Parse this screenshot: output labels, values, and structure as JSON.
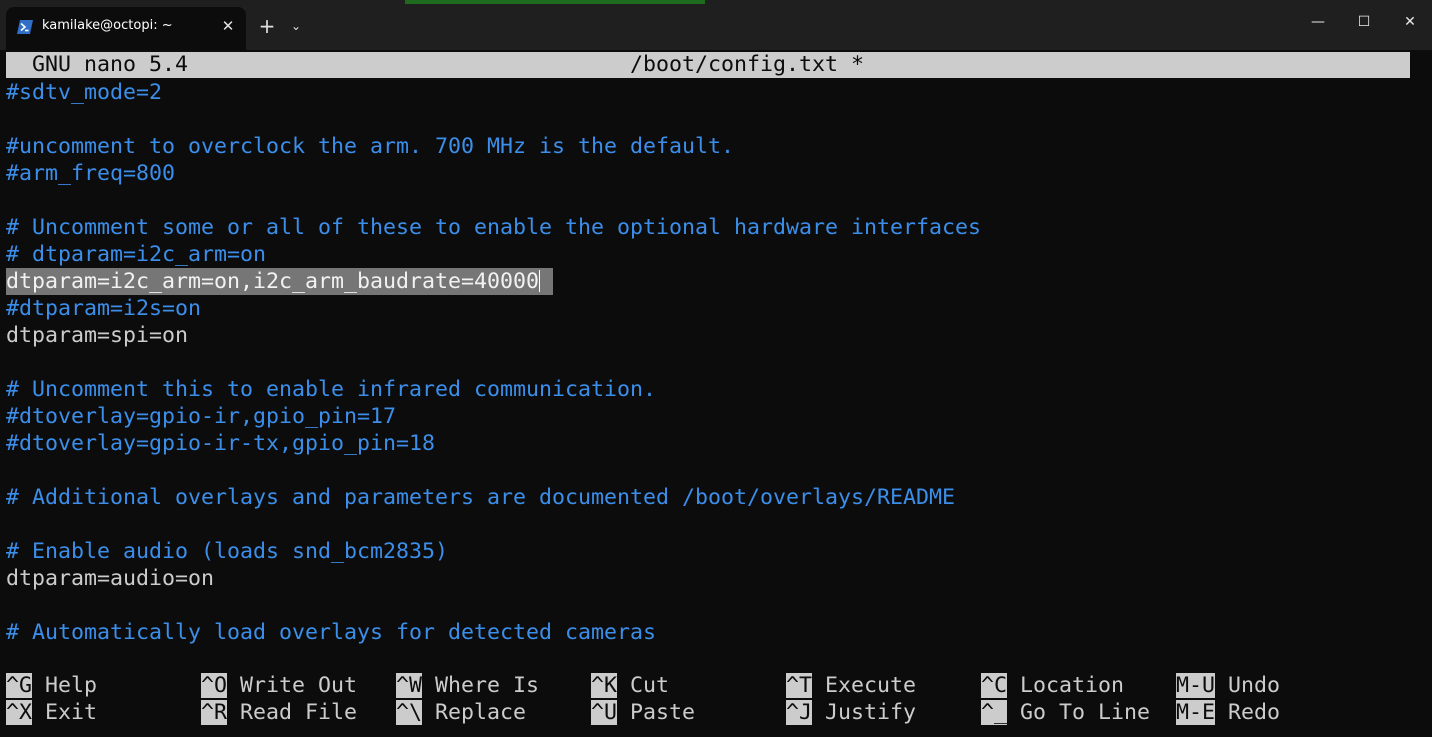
{
  "window": {
    "tab_title": "kamilake@octopi: ~",
    "tab_close_symbol": "✕",
    "new_tab_symbol": "+",
    "dropdown_symbol": "⌄",
    "minimize_symbol": "—",
    "maximize_symbol": "☐",
    "close_symbol": "✕"
  },
  "nano": {
    "version": "GNU nano 5.4",
    "filename": "/boot/config.txt *",
    "lines": [
      {
        "text": "#sdtv_mode=2",
        "kind": "comment"
      },
      {
        "text": "",
        "kind": "normal"
      },
      {
        "text": "#uncomment to overclock the arm. 700 MHz is the default.",
        "kind": "comment"
      },
      {
        "text": "#arm_freq=800",
        "kind": "comment"
      },
      {
        "text": "",
        "kind": "normal"
      },
      {
        "text": "# Uncomment some or all of these to enable the optional hardware interfaces",
        "kind": "comment"
      },
      {
        "text": "# dtparam=i2c_arm=on",
        "kind": "comment"
      },
      {
        "text": "dtparam=i2c_arm=on,i2c_arm_baudrate=40000",
        "kind": "selected"
      },
      {
        "text": "#dtparam=i2s=on",
        "kind": "comment"
      },
      {
        "text": "dtparam=spi=on",
        "kind": "normal"
      },
      {
        "text": "",
        "kind": "normal"
      },
      {
        "text": "# Uncomment this to enable infrared communication.",
        "kind": "comment"
      },
      {
        "text": "#dtoverlay=gpio-ir,gpio_pin=17",
        "kind": "comment"
      },
      {
        "text": "#dtoverlay=gpio-ir-tx,gpio_pin=18",
        "kind": "comment"
      },
      {
        "text": "",
        "kind": "normal"
      },
      {
        "text": "# Additional overlays and parameters are documented /boot/overlays/README",
        "kind": "comment"
      },
      {
        "text": "",
        "kind": "normal"
      },
      {
        "text": "# Enable audio (loads snd_bcm2835)",
        "kind": "comment"
      },
      {
        "text": "dtparam=audio=on",
        "kind": "normal"
      },
      {
        "text": "",
        "kind": "normal"
      },
      {
        "text": "# Automatically load overlays for detected cameras",
        "kind": "comment"
      }
    ],
    "shortcuts": [
      [
        {
          "key": "^G",
          "label": "Help"
        },
        {
          "key": "^O",
          "label": "Write Out"
        },
        {
          "key": "^W",
          "label": "Where Is"
        },
        {
          "key": "^K",
          "label": "Cut"
        },
        {
          "key": "^T",
          "label": "Execute"
        },
        {
          "key": "^C",
          "label": "Location"
        },
        {
          "key": "M-U",
          "label": "Undo"
        }
      ],
      [
        {
          "key": "^X",
          "label": "Exit"
        },
        {
          "key": "^R",
          "label": "Read File"
        },
        {
          "key": "^\\",
          "label": "Replace"
        },
        {
          "key": "^U",
          "label": "Paste"
        },
        {
          "key": "^J",
          "label": "Justify"
        },
        {
          "key": "^_",
          "label": "Go To Line"
        },
        {
          "key": "M-E",
          "label": "Redo"
        }
      ]
    ]
  }
}
